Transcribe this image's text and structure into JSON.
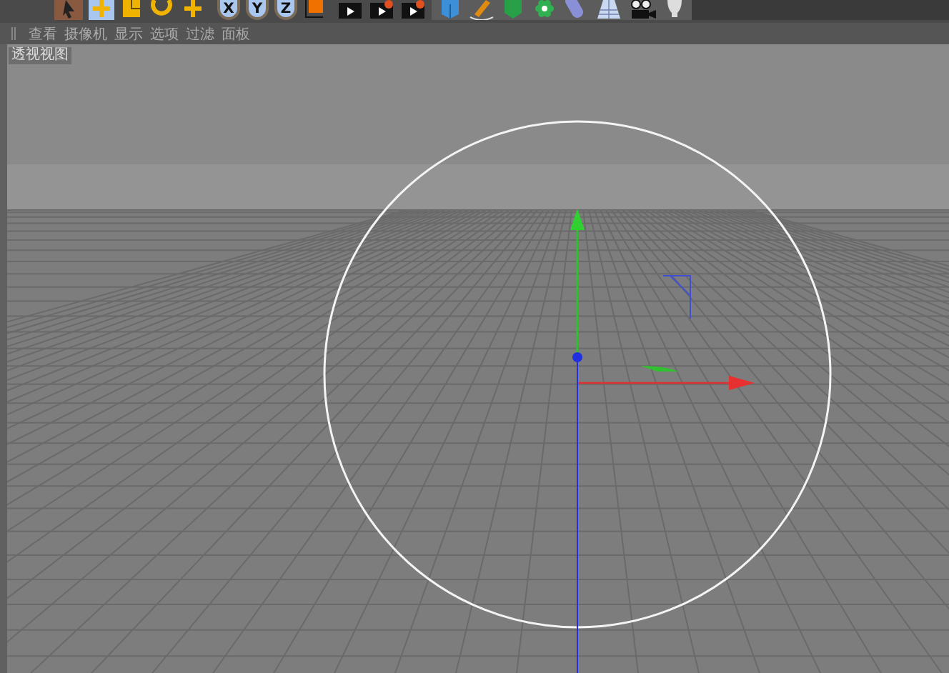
{
  "toolbar": {
    "axis_buttons": [
      {
        "label": "X",
        "on": true
      },
      {
        "label": "Y",
        "on": true
      },
      {
        "label": "Z",
        "on": true
      }
    ]
  },
  "viewport_menu": [
    "查看",
    "摄像机",
    "显示",
    "选项",
    "过滤",
    "面板"
  ],
  "viewport": {
    "title": "透视视图"
  }
}
